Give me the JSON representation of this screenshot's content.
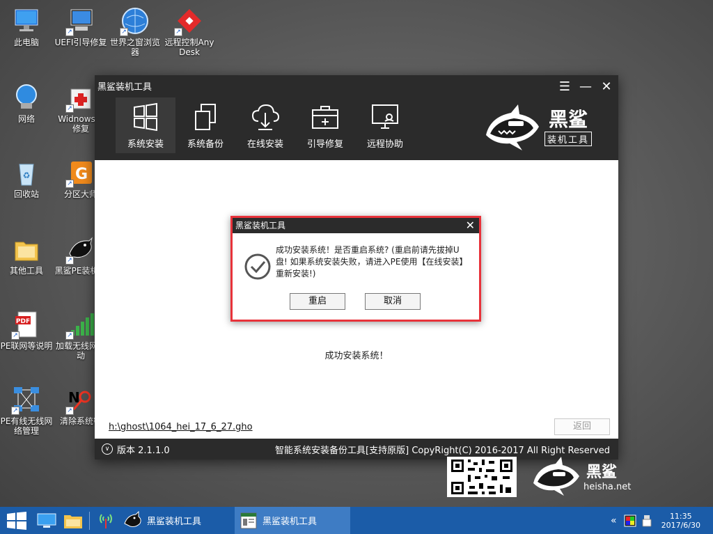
{
  "desktop": {
    "icons": [
      {
        "label": "此电脑"
      },
      {
        "label": "UEFI引导修复"
      },
      {
        "label": "世界之窗浏览器"
      },
      {
        "label": "远程控制AnyDesk"
      },
      {
        "label": "网络"
      },
      {
        "label": "Widnows导修复"
      },
      {
        "label": "回收站"
      },
      {
        "label": "分区大师"
      },
      {
        "label": "其他工具"
      },
      {
        "label": "黑鲨PE装机具"
      },
      {
        "label": "PE联网等说明"
      },
      {
        "label": "加载无线网驱动"
      },
      {
        "label": "PE有线无线网络管理"
      },
      {
        "label": "清除系统密"
      }
    ]
  },
  "window": {
    "title": "黑鲨装机工具",
    "controls": {
      "menu": "☰",
      "minimize": "—",
      "close": "✕"
    },
    "toolbar": [
      {
        "label": "系统安装",
        "active": true
      },
      {
        "label": "系统备份",
        "active": false
      },
      {
        "label": "在线安装",
        "active": false
      },
      {
        "label": "引导修复",
        "active": false
      },
      {
        "label": "远程协助",
        "active": false
      }
    ],
    "brand": {
      "name": "黑鲨",
      "sub": "装机工具"
    },
    "content": {
      "success_text": "成功安装系统！",
      "ghost_path": "h:\\ghost\\1064_hei_17_6_27.gho",
      "back_label": "返回"
    },
    "status": {
      "version": "版本 2.1.1.0",
      "copyright": "智能系统安装备份工具[支持原版]  CopyRight(C) 2016-2017 All Right Reserved"
    }
  },
  "dialog": {
    "title": "黑鲨装机工具",
    "close": "✕",
    "message": "成功安装系统！是否重启系统? (重启前请先拔掉U盘! 如果系统安装失败，请进入PE使用【在线安装】重新安装!)",
    "restart_label": "重启",
    "cancel_label": "取消"
  },
  "promo": {
    "name": "黑鲨",
    "url": "heisha.net"
  },
  "taskbar": {
    "apps": [
      {
        "label": "黑鲨装机工具",
        "active": false
      },
      {
        "label": "黑鲨装机工具",
        "active": true
      }
    ],
    "tray_chevron": "«",
    "clock_time": "11:35",
    "clock_date": "2017/6/30"
  },
  "colors": {
    "accent_red": "#e8323a",
    "titlebar": "#2b2b2b",
    "taskbar": "#1b5ca8"
  }
}
